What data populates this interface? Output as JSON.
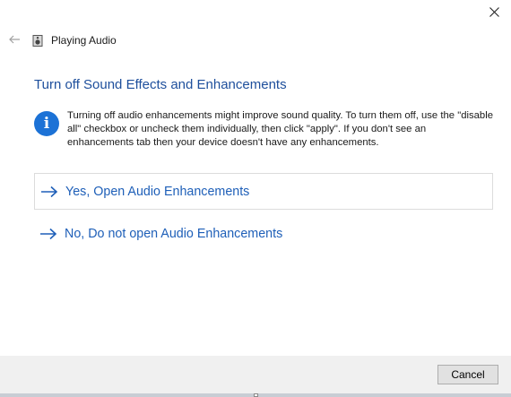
{
  "window": {
    "title": "Playing Audio",
    "close_icon": "close-icon",
    "back_icon": "back-arrow-icon",
    "app_icon": "speaker-icon"
  },
  "main": {
    "heading": "Turn off Sound Effects and Enhancements",
    "info_icon": "info-icon",
    "info_text": "Turning off audio enhancements might improve sound quality. To turn them off, use the \"disable all\" checkbox or uncheck them individually, then click \"apply\". If you don't see an enhancements tab then your device doesn't have any enhancements.",
    "options": [
      {
        "label": "Yes, Open Audio Enhancements",
        "icon": "arrow-right-icon"
      },
      {
        "label": "No, Do not open Audio Enhancements",
        "icon": "arrow-right-icon"
      }
    ]
  },
  "footer": {
    "cancel_label": "Cancel"
  },
  "colors": {
    "accent": "#1e5fb8",
    "heading": "#1e4f9c",
    "info": "#1c72d6",
    "footer_bg": "#f0f0f0"
  }
}
